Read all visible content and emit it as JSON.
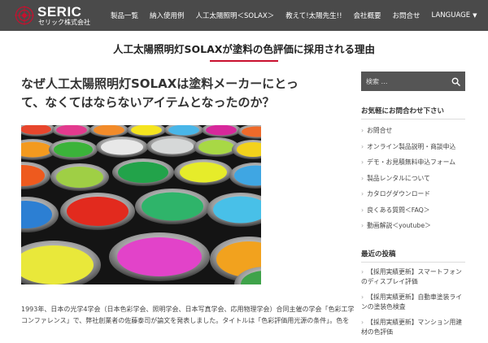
{
  "header": {
    "logo_name": "SERIC",
    "logo_sub": "セリック株式会社",
    "nav": [
      {
        "label": "製品一覧"
      },
      {
        "label": "納入使用例"
      },
      {
        "label": "人工太陽照明＜SOLAX＞"
      },
      {
        "label": "教えて!太陽先生!!"
      },
      {
        "label": "会社概要"
      },
      {
        "label": "お問合せ"
      },
      {
        "label": "LANGUAGE",
        "dropdown": true
      }
    ]
  },
  "page": {
    "title": "人工太陽照明灯SOLAXが塗料の色評価に採用される理由"
  },
  "article": {
    "title_line1": "なぜ人工太陽照明灯SOLAXは塗料メーカーにとっ",
    "title_line2": "て、なくてはならないアイテムとなったのか？",
    "body_line1": "1993年、日本の光学4学会（日本色彩学会、照明学会、日本写真学会、応用物理学会）合同主催の学会「色彩工学",
    "body_line2": "コンファレンス」で、弊社創業者の佐藤泰司が論文を発表しました。タイトルは「色彩評価用光源の条件」。色を"
  },
  "sidebar": {
    "search_placeholder": "検索 …",
    "contact_heading": "お気軽にお問合わせ下さい",
    "contact_items": [
      "お問合せ",
      "オンライン製品説明・商談申込",
      "デモ・お見積無料申込フォーム",
      "製品レンタルについて",
      "カタログダウンロード",
      "良くある質問＜FAQ＞",
      "動画解説＜youtube＞"
    ],
    "posts_heading": "最近の投稿",
    "posts": [
      "【採用実績更新】スマートフォンのディスプレイ評価",
      "【採用実績更新】自動車塗装ラインの塗装色検査",
      "【採用実績更新】マンション用建材の色評価"
    ]
  },
  "colors": {
    "header_bg": "#4a4a4a",
    "accent_red": "#c8102e",
    "search_bg": "#555555"
  }
}
